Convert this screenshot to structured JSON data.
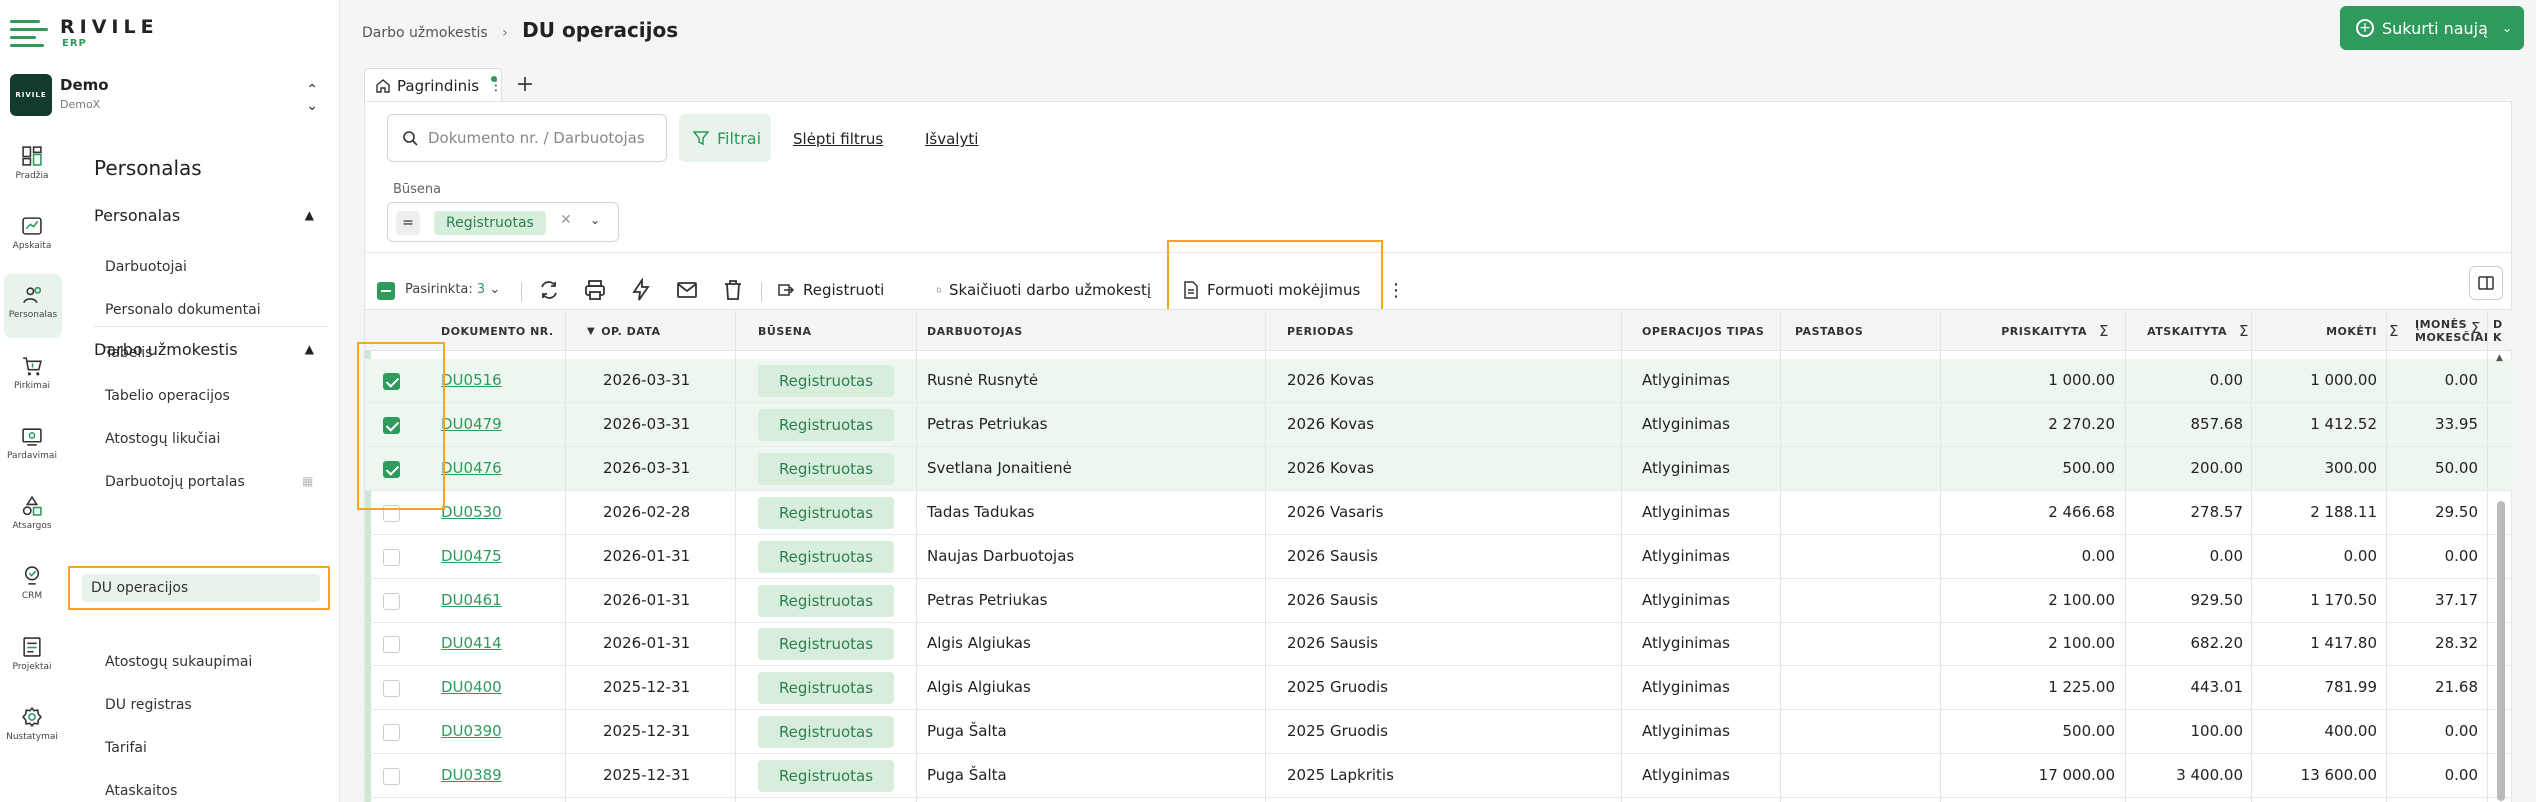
{
  "app": {
    "logo_text": "RIVILE",
    "logo_sub": "ERP",
    "company_name": "Demo",
    "company_sub": "DemoX",
    "company_badge": "RIVILE"
  },
  "rail": [
    {
      "label": "Pradžia",
      "icon": "dashboard-icon"
    },
    {
      "label": "Apskaita",
      "icon": "accounting-icon"
    },
    {
      "label": "Personalas",
      "icon": "people-icon"
    },
    {
      "label": "Pirkimai",
      "icon": "cart-icon"
    },
    {
      "label": "Pardavimai",
      "icon": "sales-icon"
    },
    {
      "label": "Atsargos",
      "icon": "shapes-icon"
    },
    {
      "label": "CRM",
      "icon": "crm-icon"
    },
    {
      "label": "Projektai",
      "icon": "projects-icon"
    },
    {
      "label": "Nustatymai",
      "icon": "gear-icon"
    }
  ],
  "subnav": {
    "title": "Personalas",
    "section1": {
      "label": "Personalas",
      "items": [
        "Darbuotojai",
        "Personalo dokumentai",
        "Tabelis",
        "Tabelio operacijos",
        "Atostogų likučiai",
        "Darbuotojų portalas"
      ]
    },
    "section2": {
      "label": "Darbo užmokestis",
      "items": [
        "DU operacijos",
        "Atostogų sukaupimai",
        "DU registras",
        "Tarifai",
        "Ataskaitos"
      ]
    }
  },
  "header": {
    "breadcrumb_parent": "Darbo užmokestis",
    "title": "DU operacijos",
    "create_label": "Sukurti naują"
  },
  "tabs": {
    "main_tab": "Pagrindinis"
  },
  "filters": {
    "search_placeholder": "Dokumento nr. / Darbuotojas",
    "filters_label": "Filtrai",
    "hide_filters": "Slėpti filtrus",
    "clear": "Išvalyti",
    "status_label": "Būsena",
    "status_op": "=",
    "status_value": "Registruotas"
  },
  "toolbar": {
    "selected_label": "Pasirinkta:",
    "selected_count": "3",
    "register": "Registruoti",
    "calculate": "Skaičiuoti darbo užmokestį",
    "form_payments": "Formuoti mokėjimus"
  },
  "columns": {
    "doc": "DOKUMENTO NR.",
    "date": "OP. DATA",
    "status": "BŪSENA",
    "employee": "DARBUOTOJAS",
    "period": "PERIODAS",
    "optype": "OPERACIJOS TIPAS",
    "notes": "PASTABOS",
    "accrued": "PRISKAITYTA",
    "deducted": "ATSKAITYTA",
    "payable": "MOKĖTI",
    "company_taxes_1": "ĮMONĖS",
    "company_taxes_2": "MOKESČIAI",
    "next_1": "D",
    "next_2": "K"
  },
  "rows": [
    {
      "doc": "DU0516",
      "date": "2026-03-31",
      "status": "Registruotas",
      "employee": "Rusnė Rusnytė",
      "period": "2026 Kovas",
      "optype": "Atlyginimas",
      "accrued": "1 000.00",
      "deducted": "0.00",
      "payable": "1 000.00",
      "taxes": "0.00",
      "selected": true
    },
    {
      "doc": "DU0479",
      "date": "2026-03-31",
      "status": "Registruotas",
      "employee": "Petras Petriukas",
      "period": "2026 Kovas",
      "optype": "Atlyginimas",
      "accrued": "2 270.20",
      "deducted": "857.68",
      "payable": "1 412.52",
      "taxes": "33.95",
      "selected": true
    },
    {
      "doc": "DU0476",
      "date": "2026-03-31",
      "status": "Registruotas",
      "employee": "Svetlana Jonaitienė",
      "period": "2026 Kovas",
      "optype": "Atlyginimas",
      "accrued": "500.00",
      "deducted": "200.00",
      "payable": "300.00",
      "taxes": "50.00",
      "selected": true
    },
    {
      "doc": "DU0530",
      "date": "2026-02-28",
      "status": "Registruotas",
      "employee": "Tadas Tadukas",
      "period": "2026 Vasaris",
      "optype": "Atlyginimas",
      "accrued": "2 466.68",
      "deducted": "278.57",
      "payable": "2 188.11",
      "taxes": "29.50",
      "selected": false
    },
    {
      "doc": "DU0475",
      "date": "2026-01-31",
      "status": "Registruotas",
      "employee": "Naujas Darbuotojas",
      "period": "2026 Sausis",
      "optype": "Atlyginimas",
      "accrued": "0.00",
      "deducted": "0.00",
      "payable": "0.00",
      "taxes": "0.00",
      "selected": false
    },
    {
      "doc": "DU0461",
      "date": "2026-01-31",
      "status": "Registruotas",
      "employee": "Petras Petriukas",
      "period": "2026 Sausis",
      "optype": "Atlyginimas",
      "accrued": "2 100.00",
      "deducted": "929.50",
      "payable": "1 170.50",
      "taxes": "37.17",
      "selected": false
    },
    {
      "doc": "DU0414",
      "date": "2026-01-31",
      "status": "Registruotas",
      "employee": "Algis Algiukas",
      "period": "2026 Sausis",
      "optype": "Atlyginimas",
      "accrued": "2 100.00",
      "deducted": "682.20",
      "payable": "1 417.80",
      "taxes": "28.32",
      "selected": false
    },
    {
      "doc": "DU0400",
      "date": "2025-12-31",
      "status": "Registruotas",
      "employee": "Algis Algiukas",
      "period": "2025 Gruodis",
      "optype": "Atlyginimas",
      "accrued": "1 225.00",
      "deducted": "443.01",
      "payable": "781.99",
      "taxes": "21.68",
      "selected": false
    },
    {
      "doc": "DU0390",
      "date": "2025-12-31",
      "status": "Registruotas",
      "employee": "Puga Šalta",
      "period": "2025 Gruodis",
      "optype": "Atlyginimas",
      "accrued": "500.00",
      "deducted": "100.00",
      "payable": "400.00",
      "taxes": "0.00",
      "selected": false
    },
    {
      "doc": "DU0389",
      "date": "2025-12-31",
      "status": "Registruotas",
      "employee": "Puga Šalta",
      "period": "2025 Lapkritis",
      "optype": "Atlyginimas",
      "accrued": "17 000.00",
      "deducted": "3 400.00",
      "payable": "13 600.00",
      "taxes": "0.00",
      "selected": false
    }
  ],
  "colors": {
    "accent": "#2e9a5b",
    "highlight": "#f6a623",
    "chip_bg": "#d8eedd"
  }
}
